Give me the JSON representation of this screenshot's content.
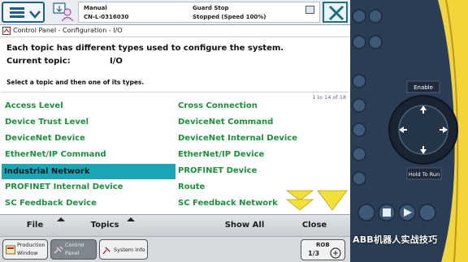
{
  "status": {
    "mode": "Manual",
    "controller": "CN-L-0316030",
    "state": "Guard Stop",
    "speed_status": "Stopped (Speed 100%)"
  },
  "header": {
    "breadcrumb": "Control Panel - Configuration - I/O",
    "description": "Each topic has different types used to configure the system.",
    "current_topic_label": "Current topic:",
    "current_topic_value": "I/O",
    "instruction": "Select a topic and then one of its types."
  },
  "list": {
    "range": "1 to 14 of 18",
    "selected": "Industrial Network",
    "left": [
      "Access Level",
      "Device Trust Level",
      "DeviceNet Device",
      "EtherNet/IP Command",
      "Industrial Network",
      "PROFINET Internal Device",
      "SC Feedback Device"
    ],
    "right": [
      "Cross Connection",
      "DeviceNet Command",
      "DeviceNet Internal Device",
      "EtherNet/IP Device",
      "PROFINET Device",
      "Route",
      "SC Feedback Network"
    ]
  },
  "menubar": {
    "file": "File",
    "topics": "Topics",
    "show_all": "Show All",
    "close": "Close"
  },
  "taskbar": {
    "production_window_line1": "Production",
    "production_window_line2": "Window",
    "control_panel_line1": "Control",
    "control_panel_line2": "Panel",
    "system_info": "System Info",
    "rob_label": "ROB",
    "rob_fraction": "1/3"
  },
  "device": {
    "enable_label": "Enable",
    "hold_to_run_label": "Hold To Run"
  },
  "watermark": "ABB机器人实战技巧",
  "colors": {
    "item_text": "#1e8f3f",
    "selected_bg": "#1aa6b7",
    "accent": "#1e5f8e",
    "arrow_yellow": "#f2df38",
    "device_body": "#2a3d55",
    "device_yellow": "#f3d43a"
  }
}
